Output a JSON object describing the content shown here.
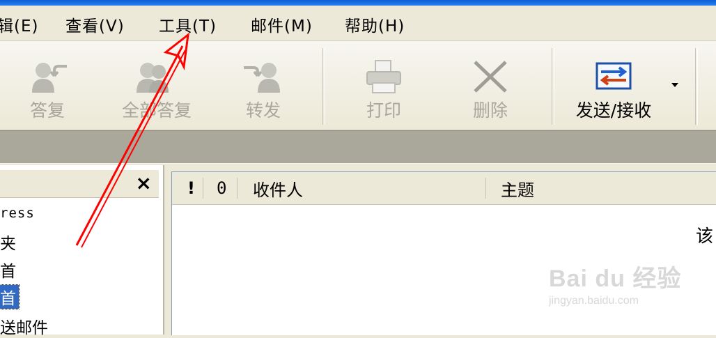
{
  "menubar": {
    "items": [
      {
        "label": "辑(E)"
      },
      {
        "label": "查看(V)"
      },
      {
        "label": "工具(T)"
      },
      {
        "label": "邮件(M)"
      },
      {
        "label": "帮助(H)"
      }
    ]
  },
  "toolbar": {
    "reply": {
      "label": "答复",
      "icon": "reply-icon",
      "enabled": false
    },
    "reply_all": {
      "label": "全部答复",
      "icon": "reply-all-icon",
      "enabled": false
    },
    "forward": {
      "label": "转发",
      "icon": "forward-icon",
      "enabled": false
    },
    "print": {
      "label": "打印",
      "icon": "printer-icon",
      "enabled": false
    },
    "delete": {
      "label": "删除",
      "icon": "delete-icon",
      "enabled": false
    },
    "send_receive": {
      "label": "发送/接收",
      "icon": "send-receive-icon",
      "enabled": true
    }
  },
  "folder_pane": {
    "close_glyph": "×",
    "items": [
      {
        "label": "ress"
      },
      {
        "label": "夹"
      },
      {
        "label": "首"
      },
      {
        "label": "首",
        "selected": true
      },
      {
        "label": "送邮件"
      }
    ]
  },
  "message_list": {
    "columns": {
      "priority": "!",
      "attachment": "0",
      "to": "收件人",
      "subject": "主题"
    },
    "empty_text": "该"
  },
  "watermark": {
    "main": "Bai du 经验",
    "sub": "jingyan.baidu.com"
  },
  "colors": {
    "selection": "#316ac5",
    "annotation_arrow": "#ff0000",
    "disabled_text": "#a9a79b"
  }
}
